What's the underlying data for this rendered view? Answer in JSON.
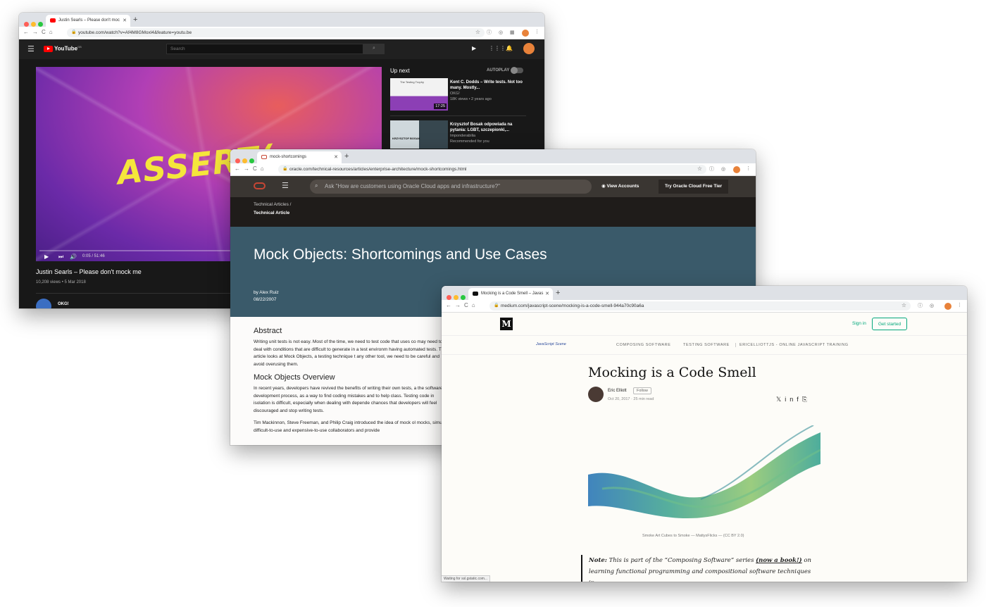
{
  "youtube": {
    "tab_title": "Justin Searls – Please don't moc",
    "url": "youtube.com/watch?v=Af4M8GMoxl4&feature=youtu.be",
    "logo": "YouTube",
    "logo_sup": "GB",
    "search_placeholder": "Search",
    "video_title_art": "ASSERT(",
    "time": "0:05 / 51:46",
    "title": "Justin Searls – Please don't mock me",
    "views": "10,208 views • 5 Mar 2018",
    "channel": "OKG!",
    "up_next": "Up next",
    "autoplay": "AUTOPLAY",
    "videos": [
      {
        "title": "Kent C. Dodds – Write tests. Not too many. Mostly...",
        "channel": "OKG!",
        "meta": "18K views • 2 years ago",
        "duration": "17:25",
        "thumb_text": "The Testing Trophy"
      },
      {
        "title": "Krzysztof Bosak odpowiada na pytania: LGBT, szczepionki,...",
        "channel": "Imponderabilia",
        "meta": "Recommended for you",
        "duration": "",
        "thumb_text": "KRZYSZTOF BOSAK"
      }
    ]
  },
  "oracle": {
    "tab_title": "mock-shortcomings",
    "url": "oracle.com/technical-resources/articles/enterprise-architecture/mock-shortcomings.html",
    "search_placeholder": "Ask \"How are customers using Oracle Cloud apps and infrastructure?\"",
    "view_accounts": "View Accounts",
    "try_free": "Try Oracle Cloud Free Tier",
    "breadcrumb_parent": "Technical Articles  /",
    "breadcrumb_current": "Technical Article",
    "title": "Mock Objects: Shortcomings and Use Cases",
    "author": "by Alex Ruiz",
    "date": "08/22/2007",
    "abstract_heading": "Abstract",
    "abstract_text": "Writing unit tests is not easy. Most of the time, we need to test code that uses co may need to deal with conditions that are difficult to generate in a test environm having automated tests. This article looks at Mock Objects, a testing technique t any other tool, we need to be careful and avoid overusing them.",
    "overview_heading": "Mock Objects Overview",
    "overview_text": "In recent years, developers have revived the benefits of writing their own tests, a the software development process, as a way to find coding mistakes and to help class. Testing code in isolation is difficult, especially when dealing with depende chances that developers will feel discouraged and stop writing tests.",
    "overview_text2": "Tim Mackinnon, Steve Freeman, and Philip Craig introduced the idea of mock ol mocks, simulate difficult-to-use and expensive-to-use collaborators and provide"
  },
  "medium": {
    "tab_title": "Mocking is a Code Smell – Javas",
    "url": "medium.com/javascript-scene/mocking-is-a-code-smell-944a70c90a6a",
    "signin": "Sign in",
    "get_started": "Get started",
    "publication": "JavaScript Scene",
    "nav": [
      "COMPOSING SOFTWARE",
      "TESTING SOFTWARE",
      "ERICELLIOTTJS - ONLINE JAVASCRIPT TRAINING"
    ],
    "title": "Mocking is a Code Smell",
    "author": "Eric Elliott",
    "follow": "Follow",
    "date": "Oct 20, 2017 · 25 min read",
    "caption": "Smoke Art Cubes to Smoke — MattysFlicks — (CC BY 2.0)",
    "note_label": "Note:",
    "note_text_1": " This is part of the “Composing Software” series ",
    "note_link": "(now a book!)",
    "note_text_2": " on learning functional programming and compositional software techniques in",
    "status": "Waiting for ssl.gstatic.com..."
  }
}
